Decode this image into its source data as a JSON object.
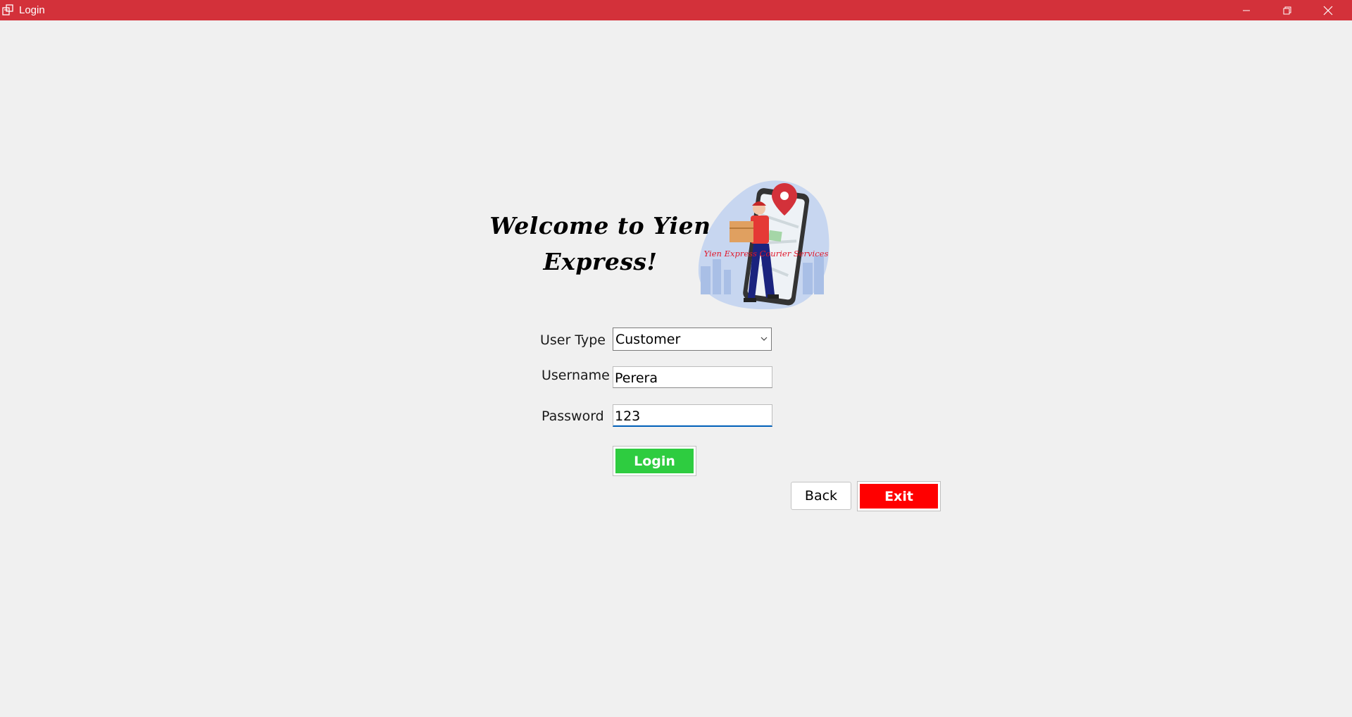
{
  "window": {
    "title": "Login",
    "icons": {
      "app": "app-window-icon",
      "minimize": "minimize-icon",
      "restore": "restore-icon",
      "close": "close-icon"
    },
    "titlebar_color": "#d3313a"
  },
  "header": {
    "welcome_line1": "Welcome to Yien",
    "welcome_line2": "Express!",
    "logo_caption": "Yien Express Courier Services"
  },
  "form": {
    "user_type_label": "User Type",
    "user_type_value": "Customer",
    "username_label": "Username",
    "username_value": "Perera",
    "password_label": "Password",
    "password_value": "123"
  },
  "buttons": {
    "login": "Login",
    "back": "Back",
    "exit": "Exit"
  },
  "colors": {
    "login_button": "#2ecc40",
    "exit_button": "#ff0000",
    "focus_underline": "#005fb8"
  }
}
